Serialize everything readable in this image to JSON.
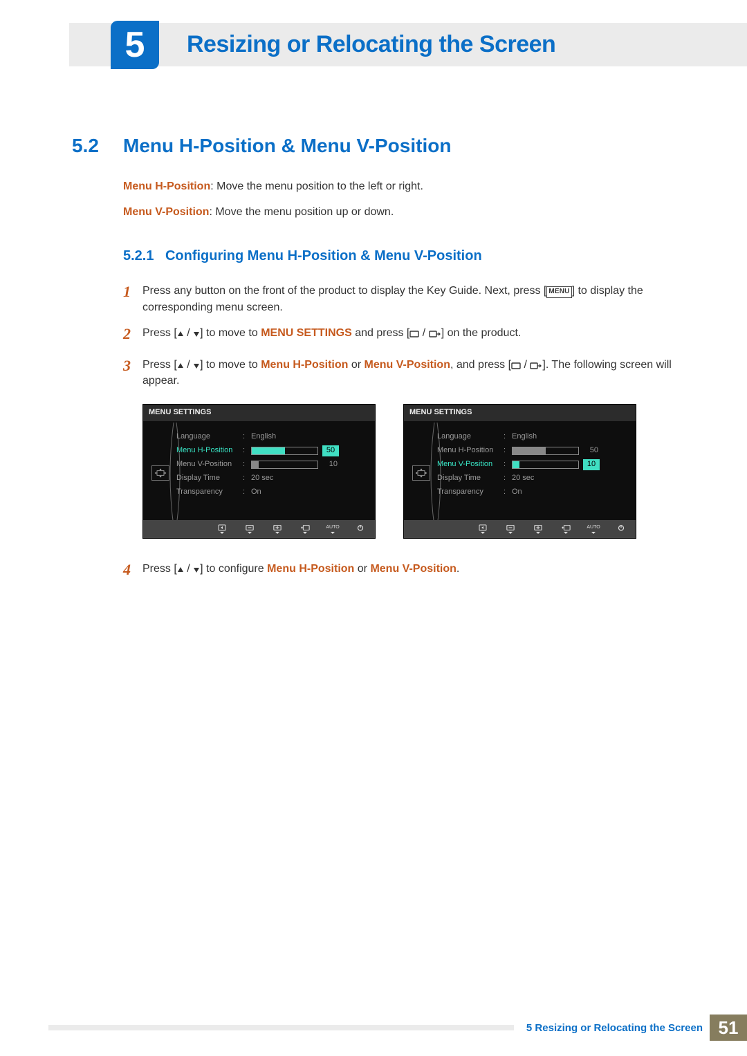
{
  "chapter_number": "5",
  "chapter_title": "Resizing or Relocating the Screen",
  "section_number": "5.2",
  "section_title": "Menu H-Position & Menu V-Position",
  "desc_h_label": "Menu H-Position",
  "desc_h_text": ": Move the menu position to the left or right.",
  "desc_v_label": "Menu V-Position",
  "desc_v_text": ": Move the menu position up or down.",
  "subsection_number": "5.2.1",
  "subsection_title": "Configuring Menu H-Position & Menu V-Position",
  "steps": {
    "s1_a": "Press any button on the front of the product to display the Key Guide. Next, press [",
    "s1_menu": "MENU",
    "s1_b": "] to display the corresponding menu screen.",
    "s2_a": "Press [",
    "s2_b": "] to move to ",
    "s2_c": "MENU SETTINGS",
    "s2_d": " and press [",
    "s2_e": "] on the product.",
    "s3_a": "Press [",
    "s3_b": "] to move to ",
    "s3_c": "Menu H-Position",
    "s3_d": " or ",
    "s3_e": "Menu V-Position",
    "s3_f": ", and press [",
    "s3_g": "]. The following screen will appear.",
    "s4_a": "Press [",
    "s4_b": "] to configure ",
    "s4_c": "Menu H-Position",
    "s4_d": " or ",
    "s4_e": "Menu V-Position",
    "s4_f": "."
  },
  "osd": {
    "title": "MENU SETTINGS",
    "labels": {
      "language": "Language",
      "h_pos": "Menu H-Position",
      "v_pos": "Menu V-Position",
      "disp_time": "Display Time",
      "transparency": "Transparency"
    },
    "values": {
      "language": "English",
      "h_pos": "50",
      "v_pos": "10",
      "disp_time": "20 sec",
      "transparency": "On"
    },
    "footer_auto": "AUTO"
  },
  "footer": {
    "chapter_ref": "5 Resizing or Relocating the Screen",
    "page": "51"
  }
}
